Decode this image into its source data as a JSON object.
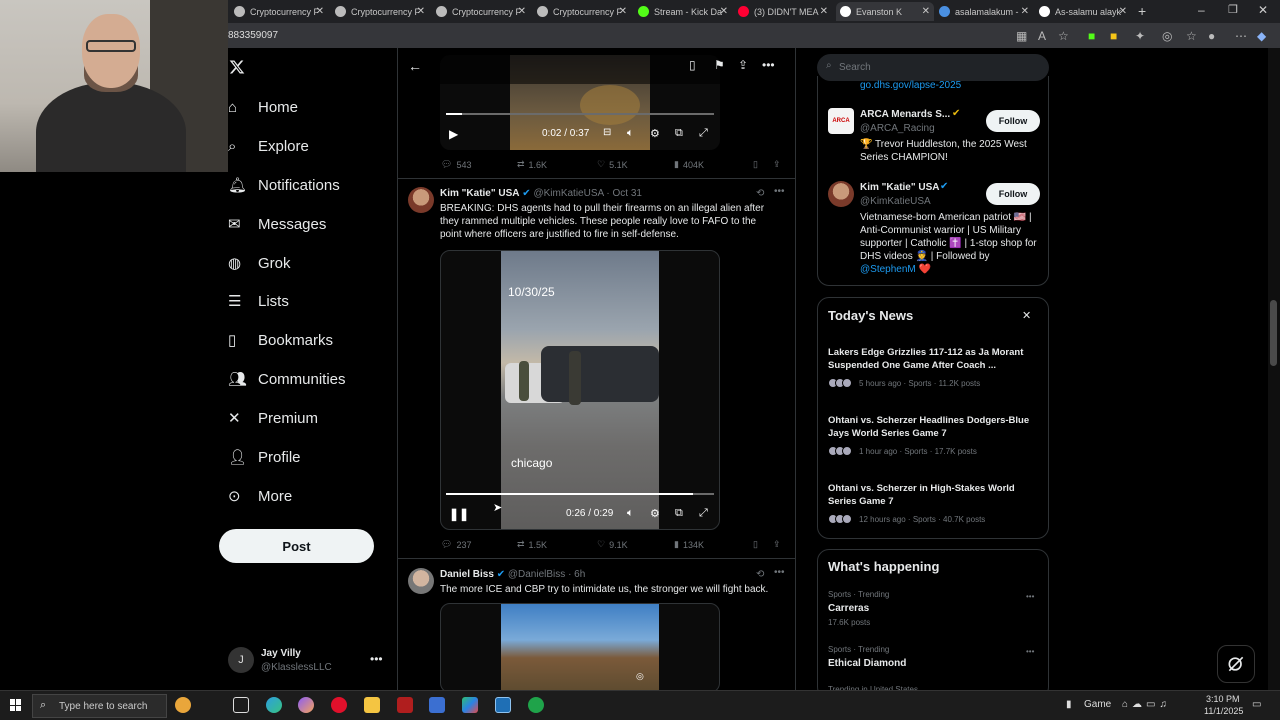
{
  "browser": {
    "tabs": [
      {
        "label": "Cryptocurrency F",
        "favicon": "twitch-icon",
        "color": "#bbbbbb"
      },
      {
        "label": "Cryptocurrency F",
        "favicon": "twitch-icon",
        "color": "#bbbbbb"
      },
      {
        "label": "Cryptocurrency F",
        "favicon": "twitch-icon",
        "color": "#bbbbbb"
      },
      {
        "label": "Cryptocurrency F",
        "favicon": "twitch-icon",
        "color": "#bbbbbb"
      },
      {
        "label": "Stream - Kick Da",
        "favicon": "kick-icon",
        "color": "#53fc18"
      },
      {
        "label": "(3) DIDN'T MEA",
        "favicon": "youtube-icon",
        "color": "#ff0033"
      },
      {
        "label": "Evanston K",
        "favicon": "x-icon",
        "color": "#ffffff"
      },
      {
        "label": "asalamalakum -",
        "favicon": "search-icon",
        "color": "#4a90e2"
      },
      {
        "label": "As-salamu alayk",
        "favicon": "wikipedia-icon",
        "color": "#ffffff"
      }
    ],
    "url_fragment": "883359097"
  },
  "nav": {
    "items": [
      {
        "label": "Home",
        "icon": "home-icon"
      },
      {
        "label": "Explore",
        "icon": "search-icon"
      },
      {
        "label": "Notifications",
        "icon": "bell-icon"
      },
      {
        "label": "Messages",
        "icon": "mail-icon"
      },
      {
        "label": "Grok",
        "icon": "grok-icon"
      },
      {
        "label": "Lists",
        "icon": "list-icon"
      },
      {
        "label": "Bookmarks",
        "icon": "bookmark-icon"
      },
      {
        "label": "Communities",
        "icon": "people-icon"
      },
      {
        "label": "Premium",
        "icon": "x-icon"
      },
      {
        "label": "Profile",
        "icon": "person-icon"
      },
      {
        "label": "More",
        "icon": "more-circle-icon"
      }
    ],
    "post_label": "Post",
    "account": {
      "initial": "J",
      "name": "Jay Villy",
      "handle": "@KlasslessLLC"
    }
  },
  "feed": {
    "tweet1": {
      "video_time": "0:02 / 0:37",
      "progress": 0.06,
      "replies": "543",
      "reposts": "1.6K",
      "likes": "5.1K",
      "views": "404K"
    },
    "tweet2": {
      "name": "Kim \"Katie\" USA",
      "handle": "@KimKatieUSA",
      "date": "· Oct 31",
      "text": "BREAKING: DHS agents had to pull their firearms on an illegal alien after they rammed multiple vehicles.  These people really love to FAFO to the point where officers are justified to fire in self-defense.",
      "video_date": "10/30/25",
      "video_caption": "chicago",
      "video_time": "0:26 / 0:29",
      "progress": 0.92,
      "replies": "237",
      "reposts": "1.5K",
      "likes": "9.1K",
      "views": "134K"
    },
    "tweet3": {
      "name": "Daniel Biss",
      "handle": "@DanielBiss",
      "date": "· 6h",
      "text": "The more ICE and CBP try to intimidate us, the stronger we will fight back."
    }
  },
  "right": {
    "search_placeholder": "Search",
    "link_cut": "go.dhs.gov/lapse-2025",
    "follow_label": "Follow",
    "suggest1": {
      "name": "ARCA Menards S...",
      "handle": "@ARCA_Racing",
      "bio": "🏆 Trevor Huddleston, the 2025 West Series CHAMPION!"
    },
    "suggest2": {
      "name": "Kim \"Katie\" USA",
      "handle": "@KimKatieUSA",
      "bio_plain": "Vietnamese-born American patriot 🇺🇸 | Anti-Communist warrior | US Military supporter | Catholic ✝️ | 1-stop shop for DHS videos 👮 | Followed by ",
      "bio_mention": "@StephenM",
      "bio_end": " ❤️"
    },
    "news_title": "Today's News",
    "news": [
      {
        "title": "Lakers Edge Grizzlies 117-112 as Ja Morant Suspended One Game After Coach ...",
        "meta": "5 hours ago · Sports · 11.2K posts"
      },
      {
        "title": "Ohtani vs. Scherzer Headlines Dodgers-Blue Jays World Series Game 7",
        "meta": "1 hour ago · Sports · 17.7K posts"
      },
      {
        "title": "Ohtani vs. Scherzer in High-Stakes World Series Game 7",
        "meta": "12 hours ago · Sports · 40.7K posts"
      }
    ],
    "happening_title": "What's happening",
    "trends": [
      {
        "category": "Sports · Trending",
        "name": "Carreras",
        "posts": "17.6K posts"
      },
      {
        "category": "Sports · Trending",
        "name": "Ethical Diamond",
        "posts": ""
      }
    ],
    "trend_cut": "Trending in United States"
  },
  "taskbar": {
    "search_placeholder": "Type here to search",
    "game_label": "Game",
    "time": "3:10 PM",
    "date": "11/1/2025"
  },
  "colors": {
    "accent": "#1d9bf0",
    "verified": "#1d9bf0",
    "bg": "#000000",
    "border": "#2f3336"
  }
}
